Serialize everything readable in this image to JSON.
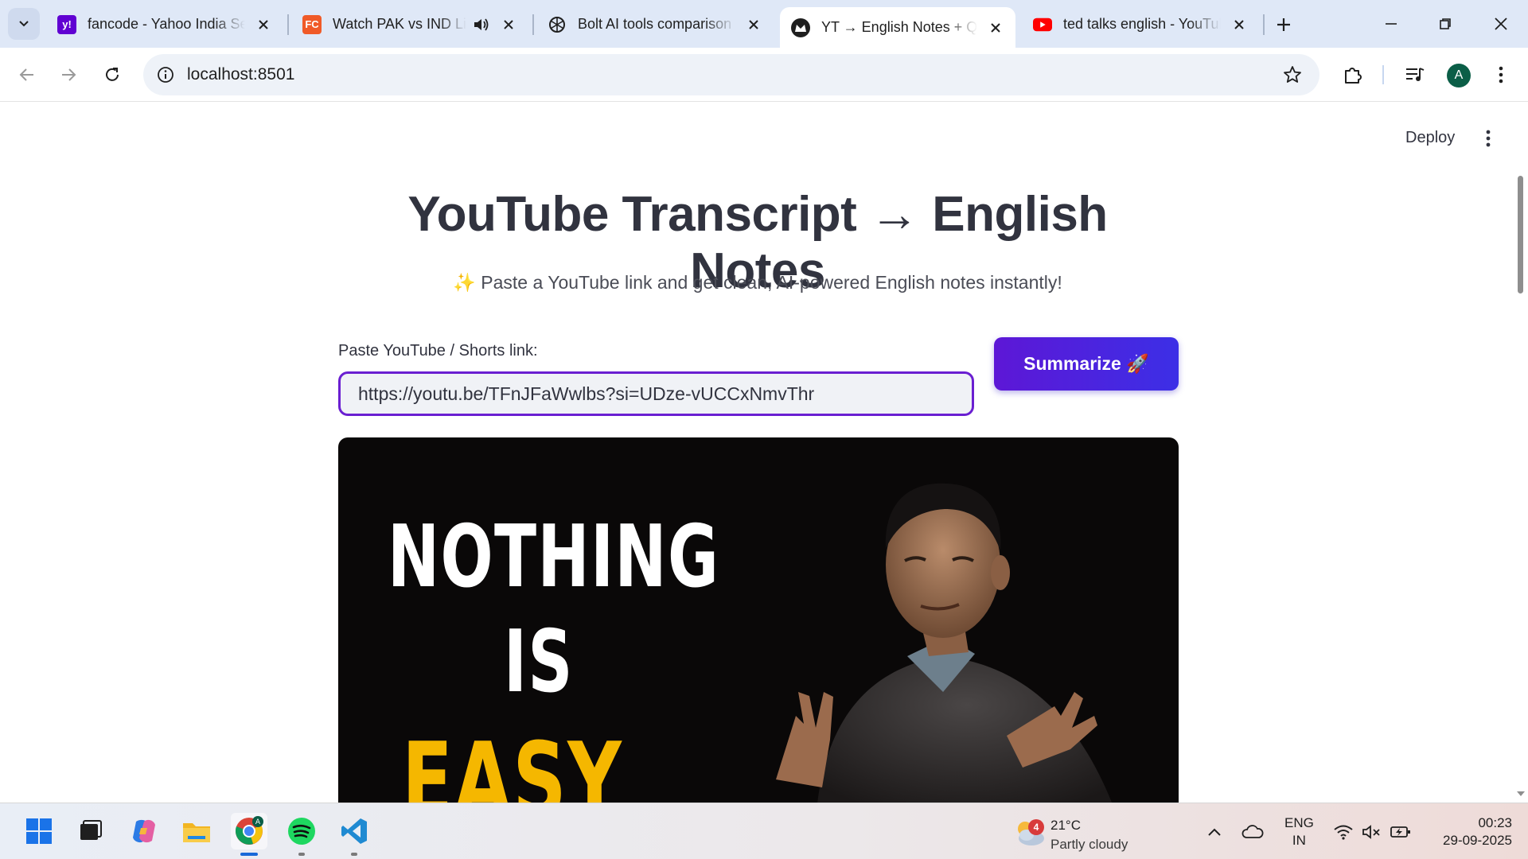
{
  "browser": {
    "tabs": [
      {
        "title": "fancode - Yahoo India Se",
        "favicon": "yahoo-favicon",
        "active": false
      },
      {
        "title": "Watch PAK vs IND Liv",
        "favicon": "fancode-favicon",
        "active": false,
        "audio": true
      },
      {
        "title": "Bolt AI tools comparison",
        "favicon": "openai-favicon",
        "active": false
      },
      {
        "title": "YT → English Notes + Q&",
        "favicon": "streamlit-favicon",
        "active": true
      },
      {
        "title": "ted talks english - YouTul",
        "favicon": "youtube-favicon",
        "active": false
      }
    ],
    "address": "localhost:8501",
    "profile_initial": "A"
  },
  "app": {
    "deploy_label": "Deploy",
    "title": "YouTube Transcript → English Notes",
    "subtitle": "✨ Paste a YouTube link and get clean, AI-powered English notes instantly!",
    "input_label": "Paste YouTube / Shorts link:",
    "input_value": "https://youtu.be/TFnJFaWwlbs?si=UDze-vUCCxNmvThr",
    "button_label": "Summarize 🚀",
    "thumbnail": {
      "line1": "NOTHING",
      "line2": "IS",
      "line3": "EASY"
    },
    "accent_color": "#6a1fd1"
  },
  "taskbar": {
    "weather_badge": "4",
    "weather_temp": "21°C",
    "weather_desc": "Partly cloudy",
    "lang_top": "ENG",
    "lang_bottom": "IN",
    "time": "00:23",
    "date": "29-09-2025"
  }
}
